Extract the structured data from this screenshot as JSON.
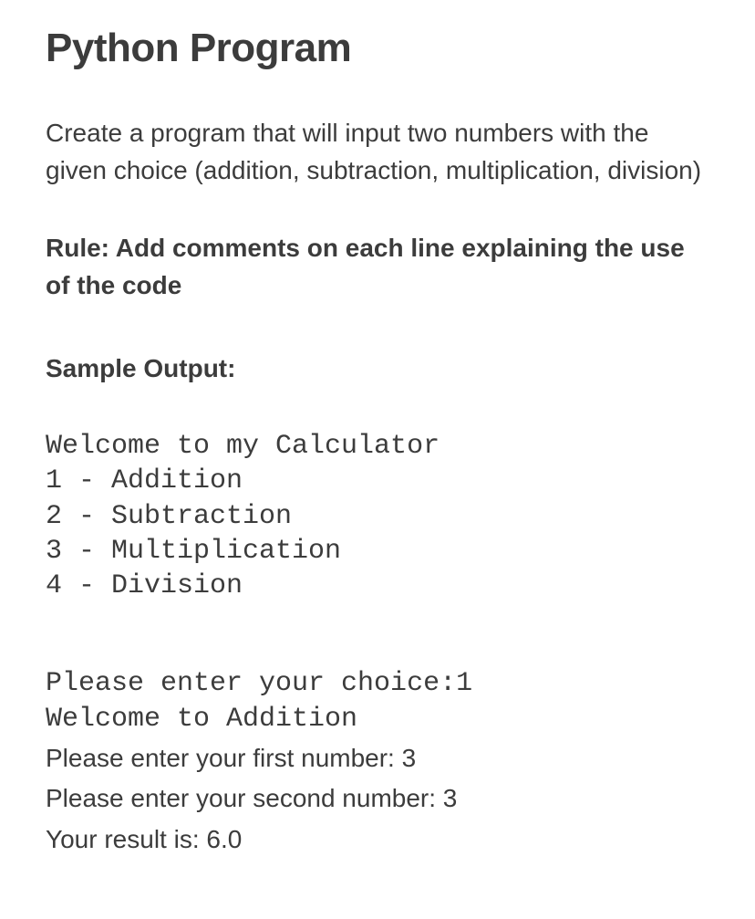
{
  "title": "Python Program",
  "description": "Create a program that will input two numbers with the given choice (addition, subtraction, multiplication, division)",
  "rule": "Rule: Add comments on each line explaining the use of the code",
  "sample_output_heading": "Sample Output:",
  "sample_welcome": "Welcome to my Calculator",
  "options": [
    "1 - Addition",
    "2 - Subtraction",
    "3 - Multiplication",
    "4 - Division"
  ],
  "choice_prompt": "Please enter your choice:1",
  "operation_welcome": "Welcome to Addition",
  "first_number_prompt": "Please enter your first number: 3",
  "second_number_prompt": "Please enter your second number: 3",
  "result": "Your result is: 6.0"
}
